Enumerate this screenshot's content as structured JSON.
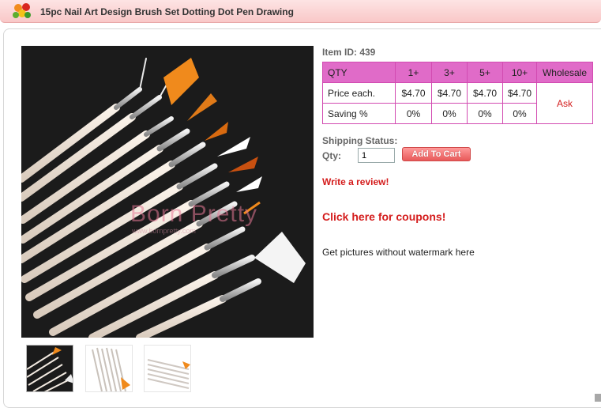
{
  "header": {
    "title": "15pc Nail Art Design Brush Set Dotting Dot Pen Drawing"
  },
  "gallery": {
    "watermark": "Born Pretty",
    "watermark_url": "www.bornpretty.com",
    "thumbnails": [
      "thumbnail-1",
      "thumbnail-2",
      "thumbnail-3"
    ]
  },
  "product": {
    "item_id": "Item ID: 439",
    "pricing": {
      "headers": [
        "QTY",
        "1+",
        "3+",
        "5+",
        "10+",
        "Wholesale"
      ],
      "rows": [
        {
          "label": "Price each.",
          "values": [
            "$4.70",
            "$4.70",
            "$4.70",
            "$4.70"
          ]
        },
        {
          "label": "Saving %",
          "values": [
            "0%",
            "0%",
            "0%",
            "0%"
          ]
        }
      ],
      "wholesale_link": "Ask"
    },
    "shipping_status_label": "Shipping Status:",
    "qty_label": "Qty:",
    "qty_value": "1",
    "add_to_cart": "Add To Cart",
    "write_review": "Write a review!",
    "coupons": "Click here for coupons!",
    "no_watermark": "Get pictures without watermark here"
  },
  "colors": {
    "table_header": "#e06bc8",
    "table_border": "#d24bb1",
    "link_red": "#d41c1c",
    "title_bar": "#f9c8c8"
  }
}
